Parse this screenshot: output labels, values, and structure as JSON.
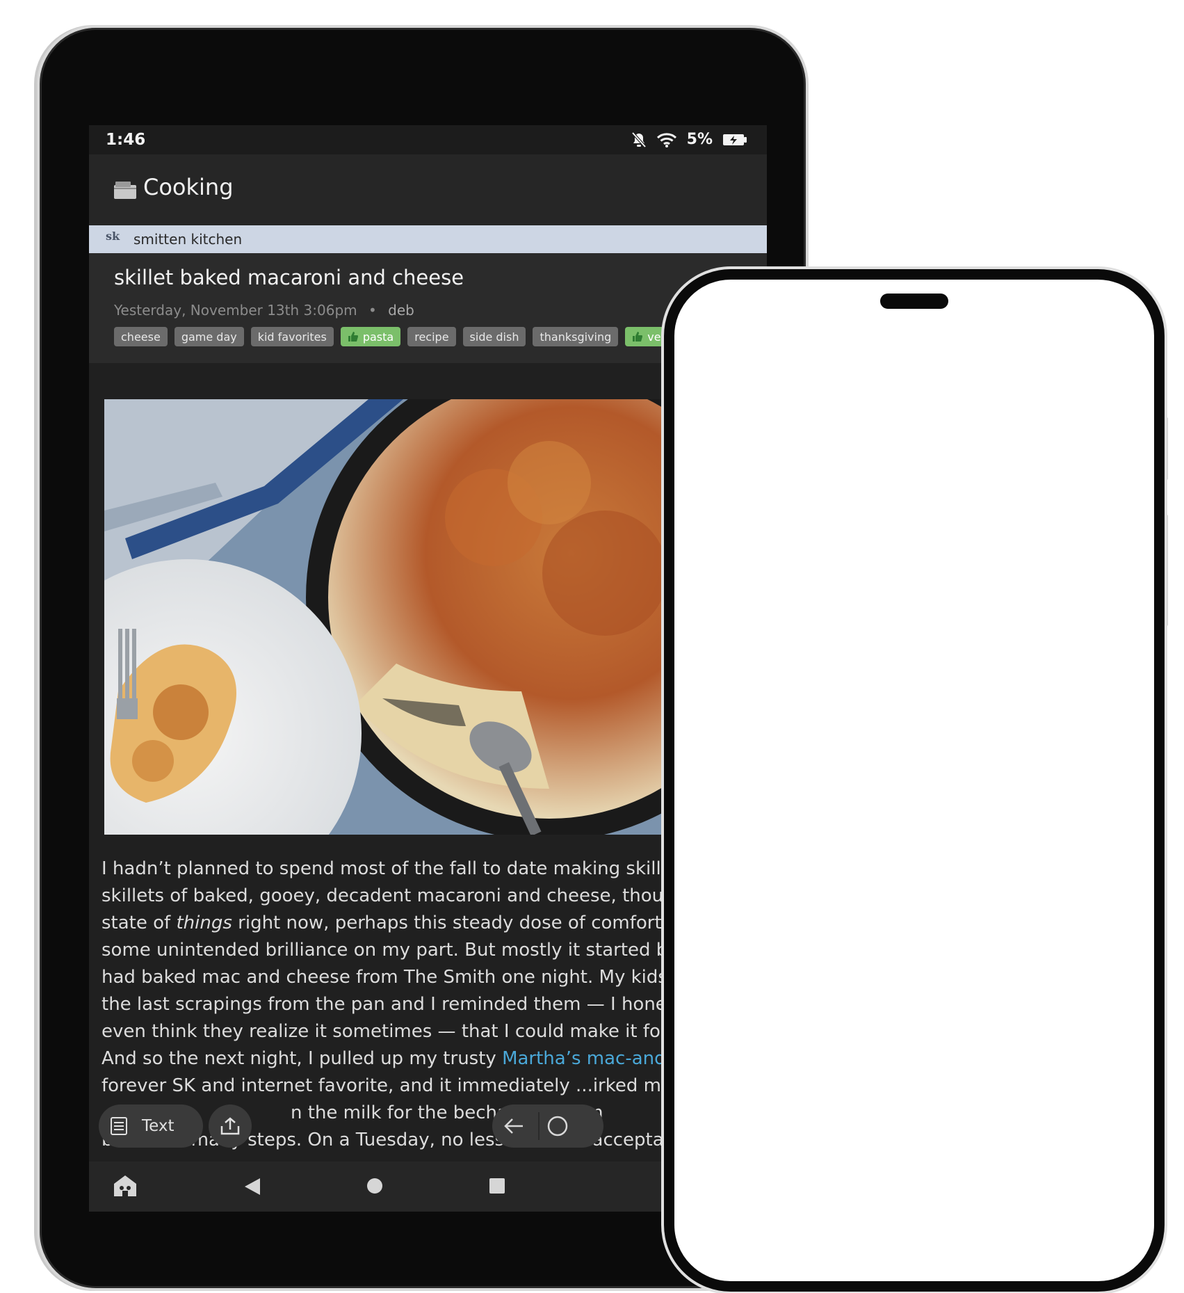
{
  "status": {
    "time": "1:46",
    "battery": "5%"
  },
  "app": {
    "title": "Cooking",
    "feed_name": "smitten kitchen",
    "feed_logo": "sk"
  },
  "article": {
    "title": "skillet baked macaroni and cheese",
    "date": "Yesterday, November 13th 3:06pm",
    "author": "deb",
    "tags": [
      {
        "label": "cheese",
        "liked": false
      },
      {
        "label": "game day",
        "liked": false
      },
      {
        "label": "kid favorites",
        "liked": false
      },
      {
        "label": "pasta",
        "liked": true
      },
      {
        "label": "recipe",
        "liked": false
      },
      {
        "label": "side dish",
        "liked": false
      },
      {
        "label": "thanksgiving",
        "liked": false
      },
      {
        "label": "vegeta",
        "liked": true
      }
    ],
    "body": {
      "l1": "I hadn’t planned to spend most of the fall to date making skillets",
      "l2": "skillets of baked, gooey, decadent macaroni and cheese, though",
      "l3a": "state of ",
      "l3em": "things",
      "l3b": " right now, perhaps this steady dose of comfort fo",
      "l4": "some unintended brilliance on my part. But mostly it started be",
      "l5": "had baked mac and cheese from The Smith one night. My kids f",
      "l6": "the last scrapings from the pan and I reminded them — I honest",
      "l7": "even think they realize it sometimes — that I could make it for t",
      "l8a": "And so the next night, I pulled up my trusty ",
      "l8link": "Martha’s mac-and-c",
      "l9": "forever SK and internet favorite, and it immediately ...irked me. S",
      "l10": "n the milk for the bechamel? So m",
      "l11": "bowls, so many steps. On a Tuesday, no less. It felt unacceptabl"
    }
  },
  "toolbar": {
    "view_mode": "Text"
  },
  "colors": {
    "screen_bg": "#202020",
    "feed_bar": "#cdd6e4",
    "liked_tag": "#7bbf6a",
    "link": "#4aa8d8"
  }
}
